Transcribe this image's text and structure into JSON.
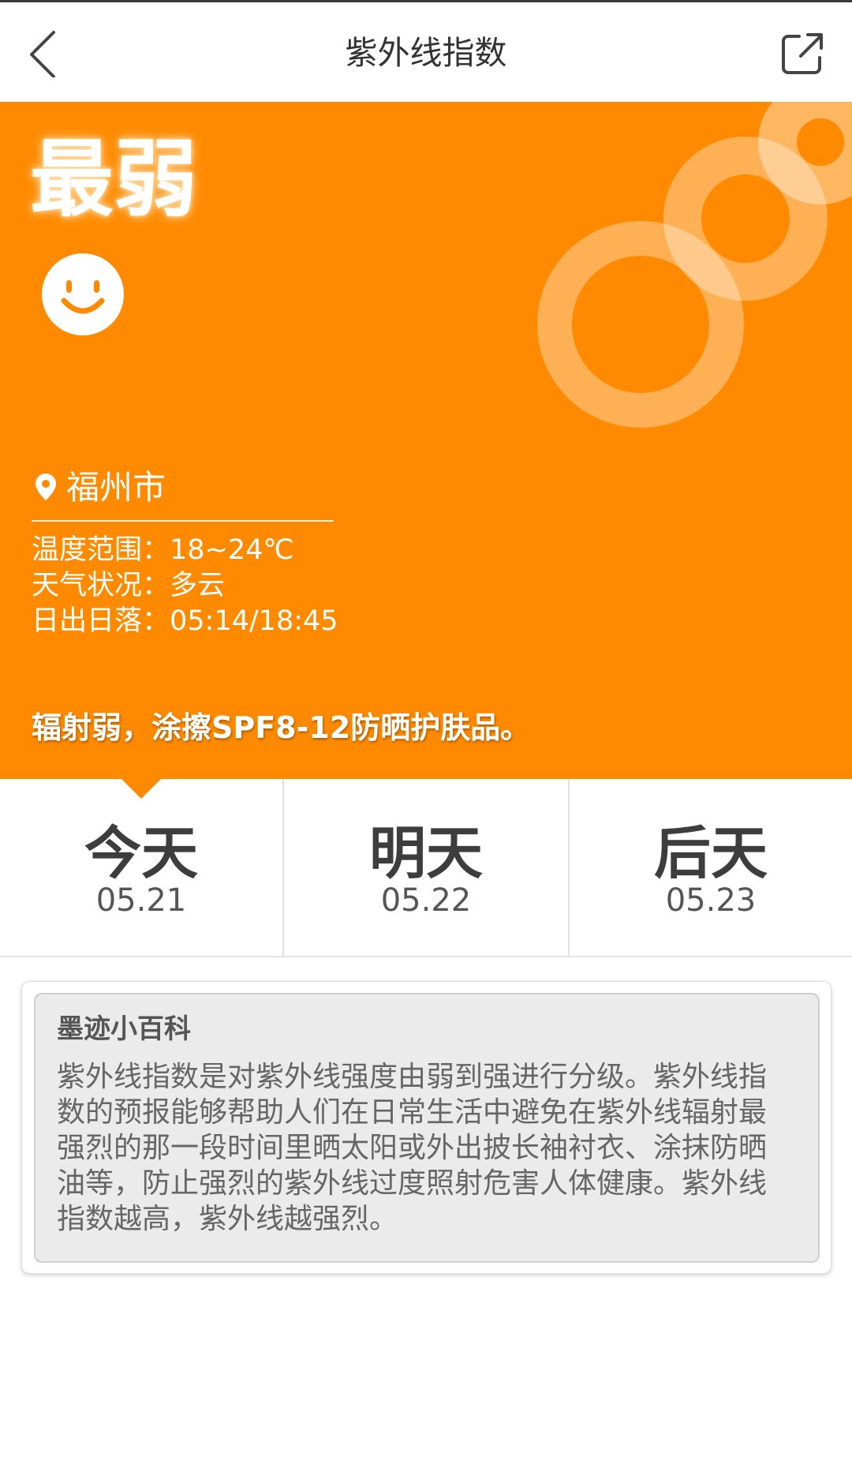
{
  "theme": {
    "accent": "#FF8A00",
    "ring_color": "rgba(255,255,255,0.33)"
  },
  "header": {
    "title": "紫外线指数",
    "back_icon": "chevron-left-icon",
    "share_icon": "share-icon"
  },
  "hero": {
    "level": "最弱",
    "level_icon": "smiley-face-icon",
    "location_icon": "location-pin-icon",
    "location": "福州市",
    "details": [
      {
        "label": "温度范围：",
        "value": "18~24℃"
      },
      {
        "label": "天气状况：",
        "value": "多云"
      },
      {
        "label": "日出日落：",
        "value": "05:14/18:45"
      }
    ],
    "advice": "辐射弱，涂擦SPF8-12防晒护肤品。"
  },
  "days": [
    {
      "label": "今天",
      "date": "05.21",
      "selected": true
    },
    {
      "label": "明天",
      "date": "05.22",
      "selected": false
    },
    {
      "label": "后天",
      "date": "05.23",
      "selected": false
    }
  ],
  "encyclopedia": {
    "title": "墨迹小百科",
    "body": "紫外线指数是对紫外线强度由弱到强进行分级。紫外线指数的预报能够帮助人们在日常生活中避免在紫外线辐射最强烈的那一段时间里晒太阳或外出披长袖衬衣、涂抹防晒油等，防止强烈的紫外线过度照射危害人体健康。紫外线指数越高，紫外线越强烈。"
  }
}
